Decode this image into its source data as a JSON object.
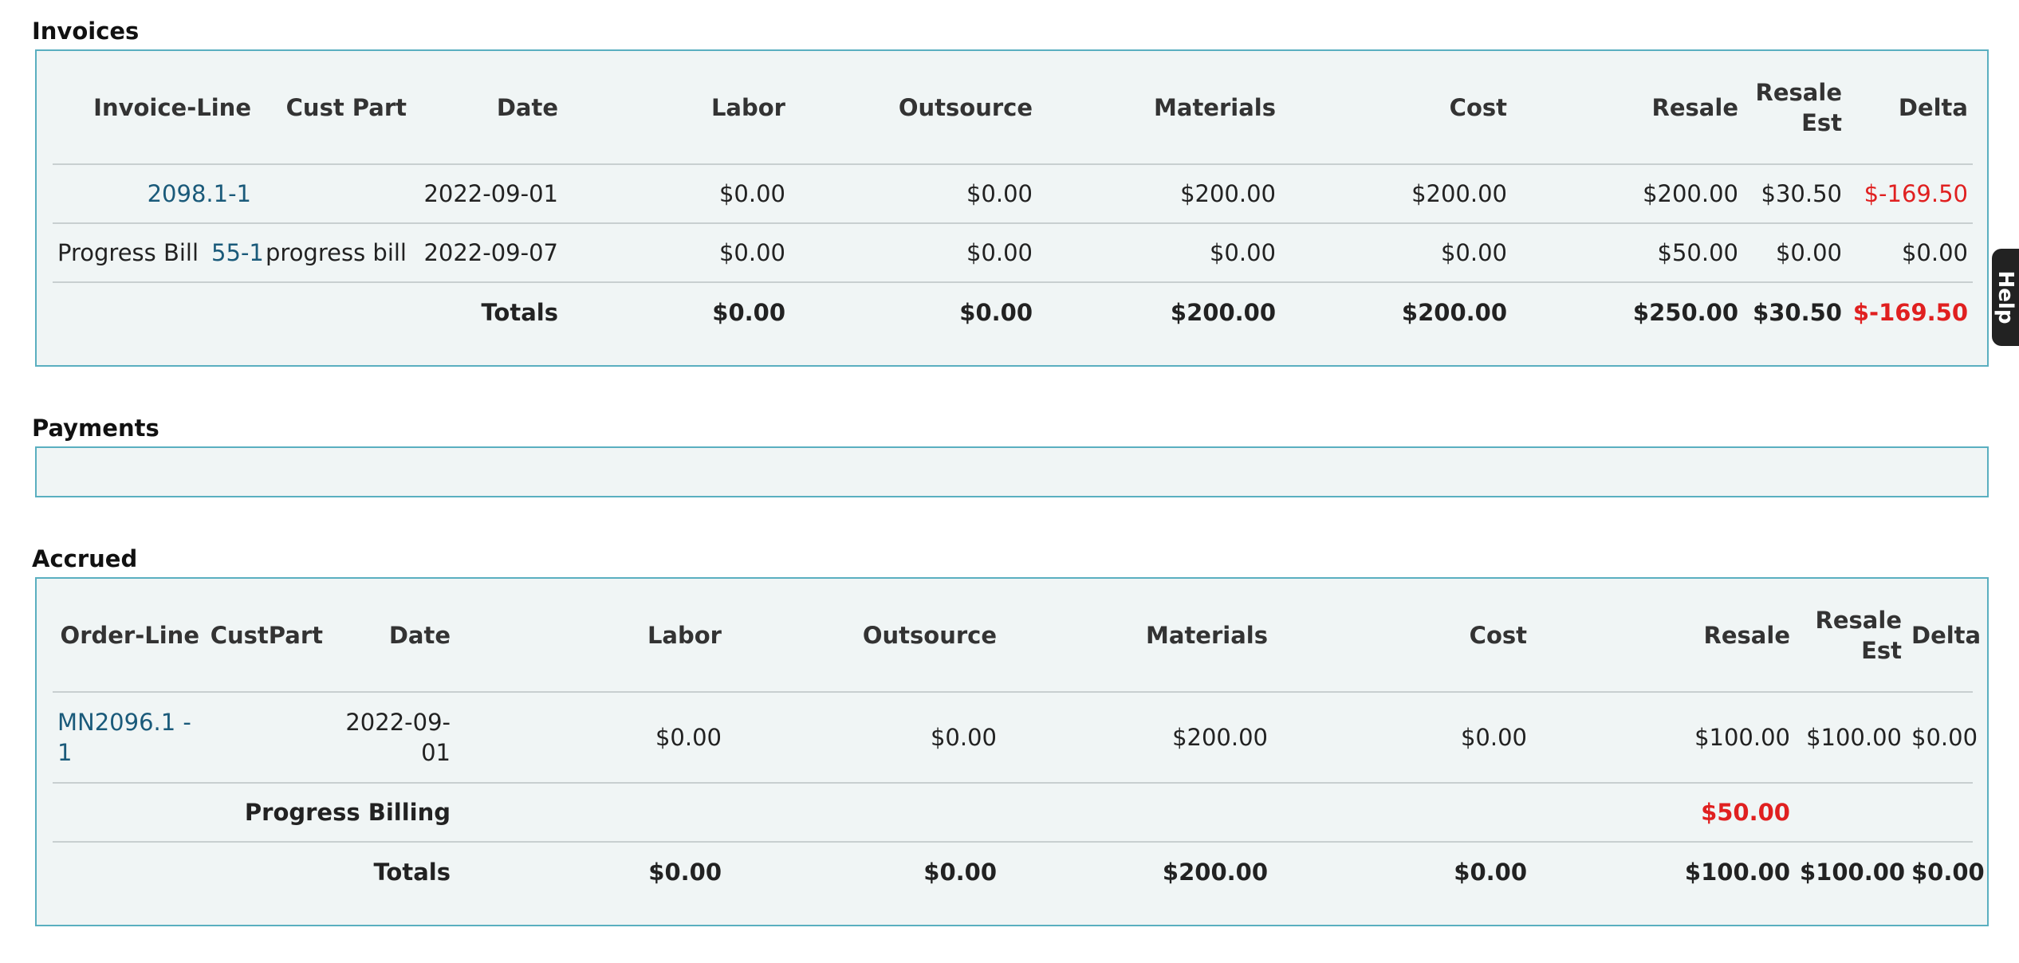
{
  "invoices": {
    "title": "Invoices",
    "columns": [
      "Invoice-Line",
      "Cust Part",
      "Date",
      "Labor",
      "Outsource",
      "Materials",
      "Cost",
      "Resale",
      "Resale Est",
      "Delta"
    ],
    "rows": [
      {
        "prefix": "",
        "link": "2098.1-1",
        "cust_part": "",
        "date": "2022-09-01",
        "labor": "$0.00",
        "outsource": "$0.00",
        "materials": "$200.00",
        "cost": "$200.00",
        "resale": "$200.00",
        "resale_est": "$30.50",
        "delta": "$-169.50"
      },
      {
        "prefix": "Progress Bill",
        "link": "55-1",
        "cust_part": "progress bill",
        "date": "2022-09-07",
        "labor": "$0.00",
        "outsource": "$0.00",
        "materials": "$0.00",
        "cost": "$0.00",
        "resale": "$50.00",
        "resale_est": "$0.00",
        "delta": "$0.00"
      }
    ],
    "totals": {
      "label": "Totals",
      "labor": "$0.00",
      "outsource": "$0.00",
      "materials": "$200.00",
      "cost": "$200.00",
      "resale": "$250.00",
      "resale_est": "$30.50",
      "delta": "$-169.50"
    }
  },
  "payments": {
    "title": "Payments"
  },
  "accrued": {
    "title": "Accrued",
    "columns": [
      "Order-Line",
      "CustPart",
      "Date",
      "Labor",
      "Outsource",
      "Materials",
      "Cost",
      "Resale",
      "Resale Est",
      "Delta"
    ],
    "rows": [
      {
        "link": "MN2096.1 - 1",
        "cust_part": "",
        "date": "2022-09-01",
        "labor": "$0.00",
        "outsource": "$0.00",
        "materials": "$200.00",
        "cost": "$0.00",
        "resale": "$100.00",
        "resale_est": "$100.00",
        "delta": "$0.00"
      }
    ],
    "progress": {
      "label": "Progress Billing",
      "resale": "$50.00"
    },
    "totals": {
      "label": "Totals",
      "labor": "$0.00",
      "outsource": "$0.00",
      "materials": "$200.00",
      "cost": "$0.00",
      "resale": "$100.00",
      "resale_est": "$100.00",
      "delta": "$0.00"
    }
  },
  "help": {
    "label": "Help"
  },
  "colors": {
    "border": "#5aafc0",
    "panel_bg": "#f0f5f5",
    "link": "#1a5a7a",
    "negative": "#e02020"
  }
}
